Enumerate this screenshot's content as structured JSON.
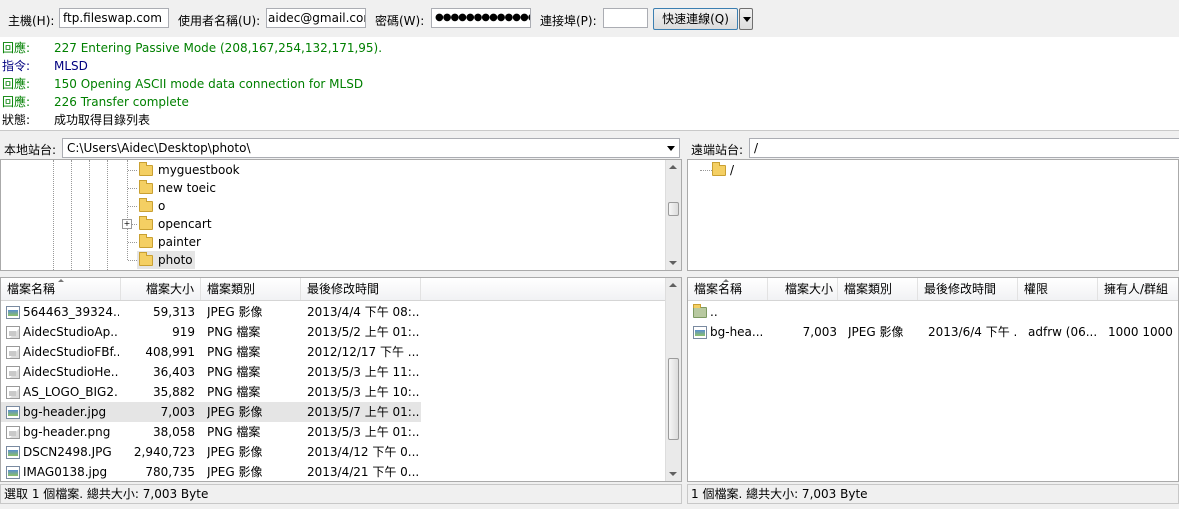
{
  "quickconnect": {
    "host_label": "主機(H):",
    "host_value": "ftp.fileswap.com",
    "user_label": "使用者名稱(U):",
    "user_value": "aidec@gmail.com",
    "pass_label": "密碼(W):",
    "pass_value": "●●●●●●●●●●●●●",
    "port_label": "連接埠(P):",
    "port_value": "",
    "connect_button": "快速連線(Q)"
  },
  "log": [
    {
      "type": "回應:",
      "text": "227 Entering Passive Mode (208,167,254,132,171,95).",
      "color": "#008000"
    },
    {
      "type": "指令:",
      "text": "MLSD",
      "color": "#000080"
    },
    {
      "type": "回應:",
      "text": "150 Opening ASCII mode data connection for MLSD",
      "color": "#008000"
    },
    {
      "type": "回應:",
      "text": "226 Transfer complete",
      "color": "#008000"
    },
    {
      "type": "狀態:",
      "text": "成功取得目錄列表",
      "color": "#000000"
    }
  ],
  "local": {
    "site_label": "本地站台:",
    "path": "C:\\Users\\Aidec\\Desktop\\photo\\",
    "tree": [
      {
        "label": "myguestbook",
        "expandable": false,
        "selected": false
      },
      {
        "label": "new toeic",
        "expandable": false,
        "selected": false
      },
      {
        "label": "o",
        "expandable": false,
        "selected": false
      },
      {
        "label": "opencart",
        "expandable": true,
        "selected": false
      },
      {
        "label": "painter",
        "expandable": false,
        "selected": false
      },
      {
        "label": "photo",
        "expandable": false,
        "selected": true
      }
    ],
    "columns": [
      "檔案名稱",
      "檔案大小",
      "檔案類別",
      "最後修改時間"
    ],
    "files": [
      {
        "name": "564463_39324...",
        "size": "59,313",
        "type": "JPEG 影像",
        "modified": "2013/4/4 下午 08:...",
        "icon": "image-file-icon",
        "selected": false
      },
      {
        "name": "AidecStudioAp...",
        "size": "919",
        "type": "PNG 檔案",
        "modified": "2013/5/2 上午 01:...",
        "icon": "png-file-icon",
        "selected": false
      },
      {
        "name": "AidecStudioFBf...",
        "size": "408,991",
        "type": "PNG 檔案",
        "modified": "2012/12/17 下午 ...",
        "icon": "png-file-icon",
        "selected": false
      },
      {
        "name": "AidecStudioHe...",
        "size": "36,403",
        "type": "PNG 檔案",
        "modified": "2013/5/3 上午 11:...",
        "icon": "png-file-icon",
        "selected": false
      },
      {
        "name": "AS_LOGO_BIG2...",
        "size": "35,882",
        "type": "PNG 檔案",
        "modified": "2013/5/3 上午 10:...",
        "icon": "png-file-icon",
        "selected": false
      },
      {
        "name": "bg-header.jpg",
        "size": "7,003",
        "type": "JPEG 影像",
        "modified": "2013/5/7 上午 01:...",
        "icon": "image-file-icon",
        "selected": true
      },
      {
        "name": "bg-header.png",
        "size": "38,058",
        "type": "PNG 檔案",
        "modified": "2013/5/3 上午 01:...",
        "icon": "png-file-icon",
        "selected": false
      },
      {
        "name": "DSCN2498.JPG",
        "size": "2,940,723",
        "type": "JPEG 影像",
        "modified": "2013/4/12 下午 0...",
        "icon": "image-file-icon",
        "selected": false
      },
      {
        "name": "IMAG0138.jpg",
        "size": "780,735",
        "type": "JPEG 影像",
        "modified": "2013/4/21 下午 0...",
        "icon": "image-file-icon",
        "selected": false
      }
    ],
    "status": "選取 1 個檔案. 總共大小: 7,003 Byte"
  },
  "remote": {
    "site_label": "遠端站台:",
    "path": "/",
    "tree": [
      {
        "label": "/"
      }
    ],
    "columns": [
      "檔案名稱",
      "檔案大小",
      "檔案類別",
      "最後修改時間",
      "權限",
      "擁有人/群組"
    ],
    "files": [
      {
        "name": "..",
        "size": "",
        "type": "",
        "modified": "",
        "perm": "",
        "owner": "",
        "icon": "parent-folder-icon"
      },
      {
        "name": "bg-hea...",
        "size": "7,003",
        "type": "JPEG 影像",
        "modified": "2013/6/4 下午 ...",
        "perm": "adfrw (06...",
        "owner": "1000 1000",
        "icon": "image-file-icon"
      }
    ],
    "status": "1 個檔案. 總共大小: 7,003 Byte"
  }
}
